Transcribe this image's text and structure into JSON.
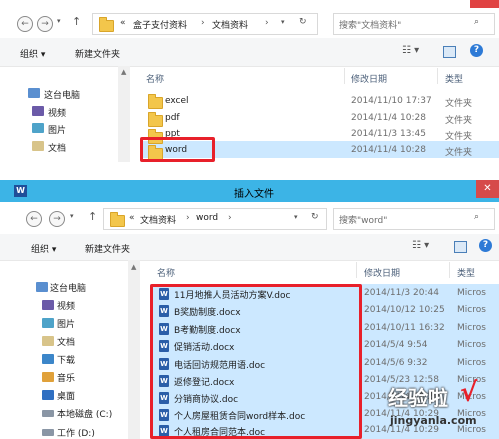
{
  "top_window": {
    "breadcrumb": [
      "«",
      "盒子支付资料",
      "文档资料"
    ],
    "search_placeholder": "搜索\"文档资料\"",
    "toolbar": {
      "organize": "组织 ▾",
      "new_folder": "新建文件夹"
    },
    "columns": {
      "name": "名称",
      "modified": "修改日期",
      "type": "类型"
    },
    "nav_items": [
      {
        "label": "这台电脑",
        "icon": "computer-icon"
      },
      {
        "label": "视频",
        "icon": "video-folder-icon"
      },
      {
        "label": "图片",
        "icon": "picture-folder-icon"
      },
      {
        "label": "文档",
        "icon": "document-folder-icon"
      }
    ],
    "files": [
      {
        "name": "excel",
        "date": "2014/11/10 17:37",
        "type": "文件夹"
      },
      {
        "name": "pdf",
        "date": "2014/11/4 10:28",
        "type": "文件夹"
      },
      {
        "name": "ppt",
        "date": "2014/11/3 13:45",
        "type": "文件夹"
      },
      {
        "name": "word",
        "date": "2014/11/4 10:28",
        "type": "文件夹"
      }
    ]
  },
  "bottom_window": {
    "title": "插入文件",
    "app_icon": "W",
    "breadcrumb": [
      "«",
      "文档资料",
      "word"
    ],
    "search_placeholder": "搜索\"word\"",
    "toolbar": {
      "organize": "组织 ▾",
      "new_folder": "新建文件夹"
    },
    "columns": {
      "name": "名称",
      "modified": "修改日期",
      "type": "类型"
    },
    "nav_items": [
      {
        "label": "这台电脑",
        "icon": "computer-icon"
      },
      {
        "label": "视频",
        "icon": "video-folder-icon"
      },
      {
        "label": "图片",
        "icon": "picture-folder-icon"
      },
      {
        "label": "文档",
        "icon": "document-folder-icon"
      },
      {
        "label": "下载",
        "icon": "download-folder-icon"
      },
      {
        "label": "音乐",
        "icon": "music-folder-icon"
      },
      {
        "label": "桌面",
        "icon": "desktop-folder-icon"
      },
      {
        "label": "本地磁盘 (C:)",
        "icon": "drive-icon"
      },
      {
        "label": "工作 (D:)",
        "icon": "drive-icon"
      }
    ],
    "files": [
      {
        "name": "11月地推人员活动方案V.doc",
        "date": "2014/11/3 20:44",
        "type": "Micros"
      },
      {
        "name": "B奖励制度.docx",
        "date": "2014/10/12 10:25",
        "type": "Micros"
      },
      {
        "name": "B考勤制度.docx",
        "date": "2014/10/11 16:32",
        "type": "Micros"
      },
      {
        "name": "促销活动.docx",
        "date": "2014/5/4 9:54",
        "type": "Micros"
      },
      {
        "name": "电话回访规范用语.doc",
        "date": "2014/5/6 9:32",
        "type": "Micros"
      },
      {
        "name": "返修登记.docx",
        "date": "2014/5/23 12:58",
        "type": "Micros"
      },
      {
        "name": "分销商协议.doc",
        "date": "2014/11/4 10:29",
        "type": "Micros"
      },
      {
        "name": "个人房屋租赁合同word样本.doc",
        "date": "2014/11/4 10:29",
        "type": "Micros"
      },
      {
        "name": "个人租房合同范本.doc",
        "date": "2014/11/4 10:29",
        "type": "Micros"
      }
    ]
  },
  "watermark": {
    "text": "经验啦",
    "url": "jingyanla.com"
  },
  "colors": {
    "titlebar": "#3cb4e6",
    "selection": "#cce8ff",
    "highlight": "#e8202a"
  }
}
